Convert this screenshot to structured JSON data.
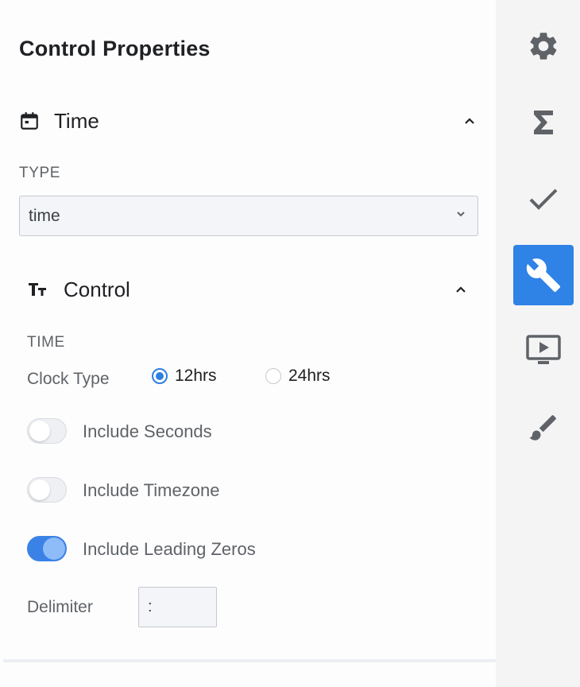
{
  "panel": {
    "title": "Control Properties",
    "time_section": {
      "label": "Time",
      "icon": "calendar-icon",
      "type_label": "TYPE",
      "type_value": "time"
    },
    "control_section": {
      "label": "Control",
      "icon": "text-format-icon",
      "time_label": "TIME",
      "clock_type_label": "Clock Type",
      "clock_options": [
        {
          "label": "12hrs",
          "checked": true
        },
        {
          "label": "24hrs",
          "checked": false
        }
      ],
      "toggles": [
        {
          "label": "Include Seconds",
          "on": false
        },
        {
          "label": "Include Timezone",
          "on": false
        },
        {
          "label": "Include Leading Zeros",
          "on": true
        }
      ],
      "delimiter_label": "Delimiter",
      "delimiter_value": ":"
    }
  },
  "rail": {
    "items": [
      {
        "icon": "gear-icon",
        "active": false
      },
      {
        "icon": "sigma-icon",
        "active": false
      },
      {
        "icon": "checkmark-icon",
        "active": false
      },
      {
        "icon": "wrench-icon",
        "active": true
      },
      {
        "icon": "video-play-icon",
        "active": false
      },
      {
        "icon": "paintbrush-icon",
        "active": false
      }
    ]
  },
  "colors": {
    "accent": "#2f82e6",
    "toggle_on": "#3b82e6",
    "icon_gray": "#5f6368"
  }
}
